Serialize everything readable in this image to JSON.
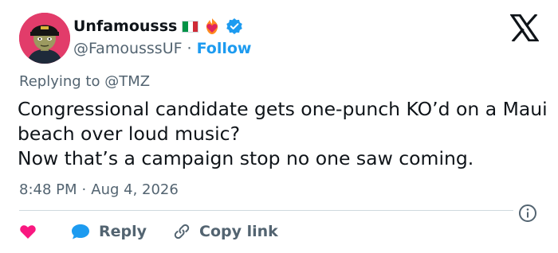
{
  "author": {
    "display_name": "Unfamousss",
    "handle": "@FamousssUF",
    "separator": "·",
    "follow_label": "Follow",
    "flag_colors": [
      "#009246",
      "#ffffff",
      "#ce2b37"
    ]
  },
  "tweet": {
    "replying_prefix": "Replying to",
    "replying_to": "@TMZ",
    "text": "Congressional candidate gets one-punch KO’d on a Maui beach over loud music?\nNow that’s a campaign stop no one saw coming.",
    "time": "8:48 PM",
    "separator": "·",
    "date": "Aug 4, 2026"
  },
  "actions": {
    "reply_label": "Reply",
    "copy_link_label": "Copy link"
  },
  "colors": {
    "accent": "#1d9bf0",
    "like": "#f91880",
    "muted": "#536471",
    "text": "#0f1419"
  },
  "icons": [
    "avatar",
    "italy-flag-icon",
    "heart-on-fire-icon",
    "verified-badge-icon",
    "x-logo-icon",
    "info-icon",
    "heart-icon",
    "reply-bubble-icon",
    "link-icon"
  ]
}
